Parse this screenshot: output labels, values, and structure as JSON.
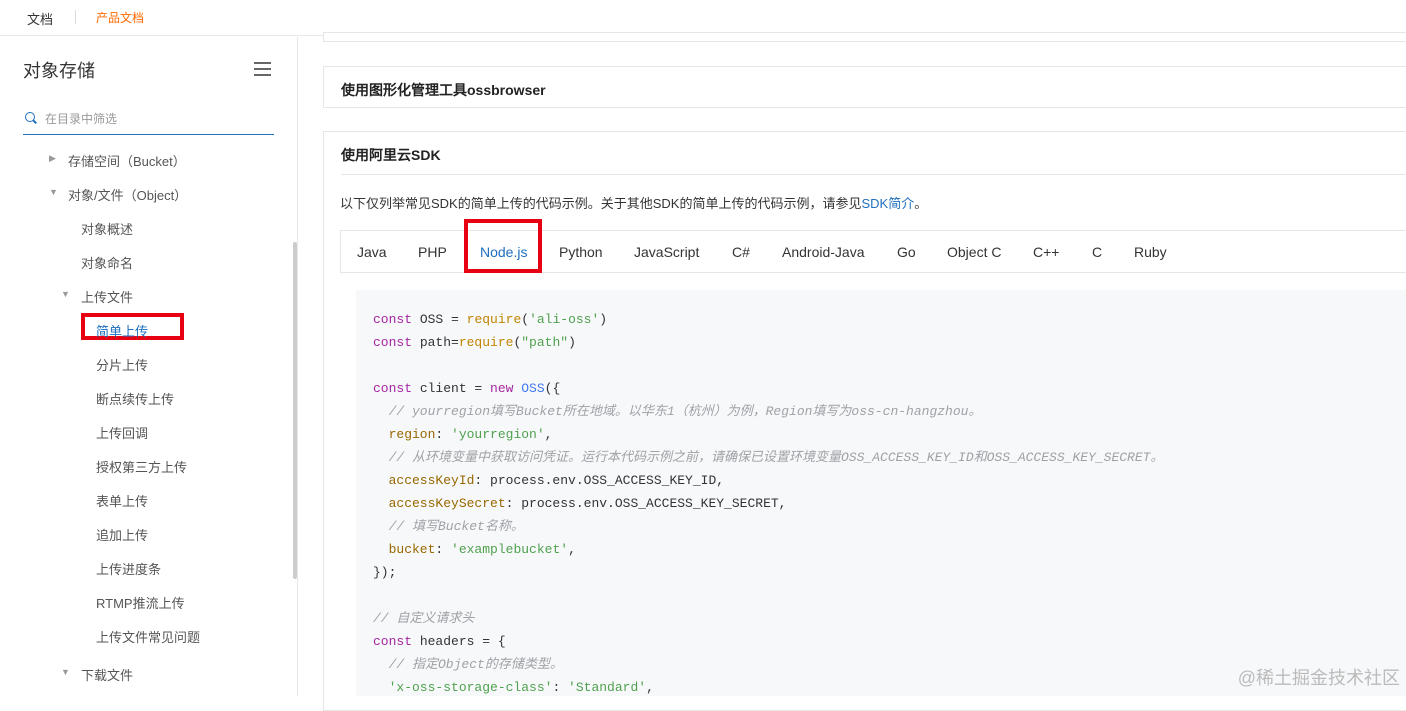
{
  "topbar": {
    "doc": "文档",
    "product_doc": "产品文档"
  },
  "sidebar": {
    "title": "对象存储",
    "search_placeholder": "在目录中筛选",
    "items": [
      {
        "label": "存储空间（Bucket）"
      },
      {
        "label": "对象/文件（Object）"
      },
      {
        "label": "对象概述"
      },
      {
        "label": "对象命名"
      },
      {
        "label": "上传文件"
      },
      {
        "label": "简单上传"
      },
      {
        "label": "分片上传"
      },
      {
        "label": "断点续传上传"
      },
      {
        "label": "上传回调"
      },
      {
        "label": "授权第三方上传"
      },
      {
        "label": "表单上传"
      },
      {
        "label": "追加上传"
      },
      {
        "label": "上传进度条"
      },
      {
        "label": "RTMP推流上传"
      },
      {
        "label": "上传文件常见问题"
      },
      {
        "label": "下载文件"
      }
    ]
  },
  "main": {
    "section_ossbrowser": "使用图形化管理工具ossbrowser",
    "section_sdk": "使用阿里云SDK",
    "intro_text": "以下仅列举常见SDK的简单上传的代码示例。关于其他SDK的简单上传的代码示例，请参见",
    "intro_link": "SDK简介",
    "intro_end": "。",
    "tabs": [
      "Java",
      "PHP",
      "Node.js",
      "Python",
      "JavaScript",
      "C#",
      "Android-Java",
      "Go",
      "Object C",
      "C++",
      "C",
      "Ruby"
    ],
    "active_tab": "Node.js"
  },
  "code": {
    "l1_a": "const",
    "l1_b": " OSS ",
    "l1_c": "= ",
    "l1_d": "require",
    "l1_e": "(",
    "l1_f": "'ali-oss'",
    "l1_g": ")",
    "l2_a": "const",
    "l2_b": " path=",
    "l2_c": "require",
    "l2_d": "(",
    "l2_e": "\"path\"",
    "l2_f": ")",
    "l4_a": "const",
    "l4_b": " client = ",
    "l4_c": "new",
    "l4_d": " ",
    "l4_e": "OSS",
    "l4_f": "({",
    "l5": "  // yourregion填写Bucket所在地域。以华东1（杭州）为例，Region填写为oss-cn-hangzhou。",
    "l6_a": "  region",
    "l6_b": ": ",
    "l6_c": "'yourregion'",
    "l6_d": ",",
    "l7": "  // 从环境变量中获取访问凭证。运行本代码示例之前，请确保已设置环境变量OSS_ACCESS_KEY_ID和OSS_ACCESS_KEY_SECRET。",
    "l8_a": "  accessKeyId",
    "l8_b": ": process.env.OSS_ACCESS_KEY_ID,",
    "l9_a": "  accessKeySecret",
    "l9_b": ": process.env.OSS_ACCESS_KEY_SECRET,",
    "l10": "  // 填写Bucket名称。",
    "l11_a": "  bucket",
    "l11_b": ": ",
    "l11_c": "'examplebucket'",
    "l11_d": ",",
    "l12": "});",
    "l14": "// 自定义请求头",
    "l15_a": "const",
    "l15_b": " headers = {",
    "l16": "  // 指定Object的存储类型。",
    "l17_a": "  'x-oss-storage-class'",
    "l17_b": ": ",
    "l17_c": "'Standard'",
    "l17_d": ","
  },
  "watermark": "@稀土掘金技术社区"
}
